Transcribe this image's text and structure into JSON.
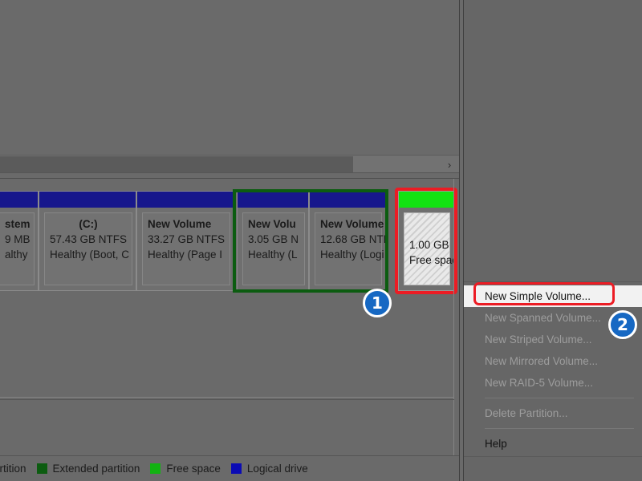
{
  "window": {
    "background_color": "#6a6a6a",
    "accent_highlight_color": "#ec1c24",
    "badge_color": "#1668c3"
  },
  "scrollbar": {
    "right_arrow_glyph": "›",
    "thumb_label": ""
  },
  "disk_graphical_view": {
    "partitions": [
      {
        "name": "system-partition",
        "bar_color": "#17178c",
        "title": "stem",
        "size": "9 MB",
        "status": "althy",
        "clipped": true
      },
      {
        "name": "c-drive-partition",
        "bar_color": "#17178c",
        "title": "(C:)",
        "size": "57.43 GB NTFS",
        "status": "Healthy (Boot, C"
      },
      {
        "name": "new-volume-partition",
        "bar_color": "#17178c",
        "title": "New Volume",
        "size": "33.27 GB NTFS",
        "status": "Healthy (Page I"
      },
      {
        "name": "logical-volume-1",
        "bar_color": "#17178c",
        "title": "New Volu",
        "size": "3.05 GB N",
        "status": "Healthy (L"
      },
      {
        "name": "logical-volume-2",
        "bar_color": "#17178c",
        "title": "New Volume",
        "size": "12.68 GB NTF",
        "status": "Healthy (Logi"
      },
      {
        "name": "free-space-partition",
        "bar_color": "#12e212",
        "title": "",
        "size": "1.00 GB",
        "status": "Free spac",
        "hatched": true,
        "selected": true
      }
    ],
    "extended_partition_outline_color": "#0c5c10"
  },
  "legend": {
    "items": [
      {
        "label": "ary partition",
        "color": "#17178c"
      },
      {
        "label": "Extended partition",
        "color": "#0c5c10"
      },
      {
        "label": "Free space",
        "color": "#12b312"
      },
      {
        "label": "Logical drive",
        "color": "#0b0bb4"
      }
    ]
  },
  "context_menu": {
    "items": [
      {
        "label": "New Simple Volume...",
        "enabled": true,
        "highlighted": true
      },
      {
        "label": "New Spanned Volume...",
        "enabled": false,
        "highlighted": false
      },
      {
        "label": "New Striped Volume...",
        "enabled": false,
        "highlighted": false
      },
      {
        "label": "New Mirrored Volume...",
        "enabled": false,
        "highlighted": false
      },
      {
        "label": "New RAID-5 Volume...",
        "enabled": false,
        "highlighted": false
      },
      {
        "separator": true
      },
      {
        "label": "Delete Partition...",
        "enabled": false,
        "highlighted": false
      },
      {
        "separator": true
      },
      {
        "label": "Help",
        "enabled": true,
        "highlighted": false
      }
    ]
  },
  "callouts": [
    {
      "name": "step-1",
      "label": "1"
    },
    {
      "name": "step-2",
      "label": "2"
    }
  ]
}
